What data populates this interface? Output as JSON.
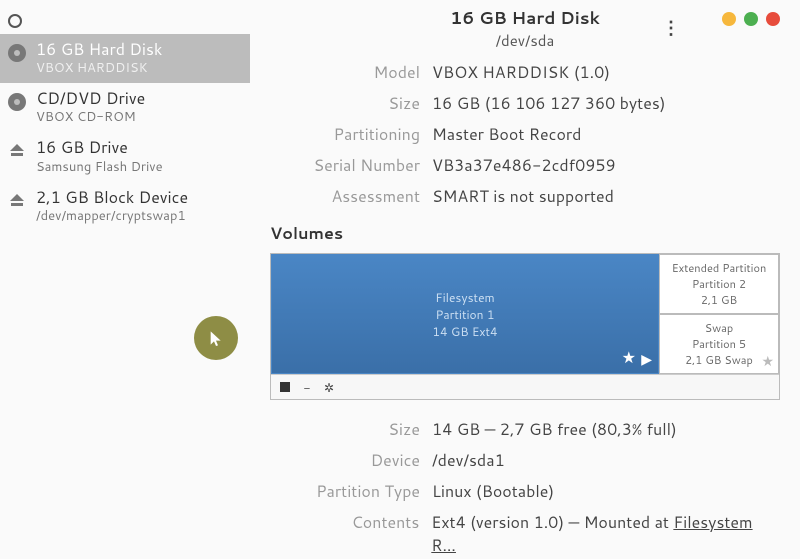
{
  "header": {
    "title": "16 GB Hard Disk",
    "subtitle": "/dev/sda"
  },
  "sidebar": {
    "items": [
      {
        "title": "16 GB Hard Disk",
        "sub": "VBOX HARDDISK",
        "icon": "disk",
        "selected": true
      },
      {
        "title": "CD/DVD Drive",
        "sub": "VBOX CD-ROM",
        "icon": "disk",
        "selected": false
      },
      {
        "title": "16 GB Drive",
        "sub": "Samsung Flash Drive",
        "icon": "eject",
        "selected": false
      },
      {
        "title": "2,1 GB Block Device",
        "sub": "/dev/mapper/cryptswap1",
        "icon": "eject",
        "selected": false
      }
    ]
  },
  "disk_info": {
    "model_label": "Model",
    "model": "VBOX HARDDISK (1.0)",
    "size_label": "Size",
    "size": "16 GB (16 106 127 360 bytes)",
    "partitioning_label": "Partitioning",
    "partitioning": "Master Boot Record",
    "serial_label": "Serial Number",
    "serial": "VB3a37e486-2cdf0959",
    "assessment_label": "Assessment",
    "assessment": "SMART is not supported"
  },
  "volumes": {
    "heading": "Volumes",
    "main": {
      "name": "Filesystem",
      "part": "Partition 1",
      "size": "14 GB Ext4"
    },
    "ext": {
      "name": "Extended Partition",
      "part": "Partition 2",
      "size": "2,1 GB"
    },
    "swap": {
      "name": "Swap",
      "part": "Partition 5",
      "size": "2,1 GB Swap"
    }
  },
  "partition_info": {
    "size_label": "Size",
    "size": "14 GB — 2,7 GB free (80,3% full)",
    "device_label": "Device",
    "device": "/dev/sda1",
    "ptype_label": "Partition Type",
    "ptype": "Linux (Bootable)",
    "contents_label": "Contents",
    "contents_pre": "Ext4 (version 1.0) — Mounted at ",
    "contents_link": "Filesystem R…"
  }
}
